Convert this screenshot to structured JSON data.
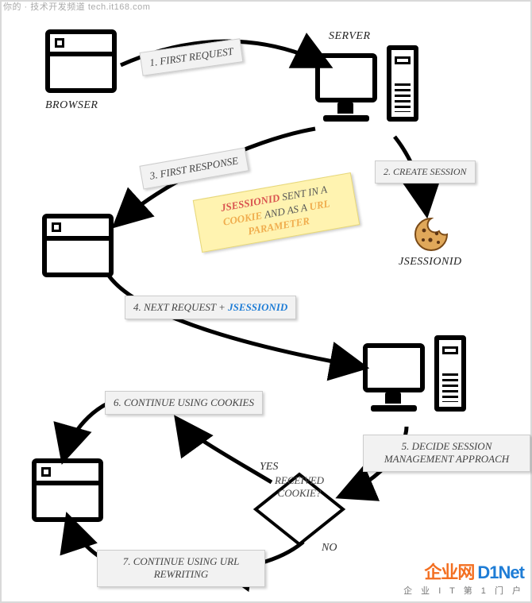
{
  "watermark_top": "你的 · 技术开发频道  tech.it168.com",
  "watermark_bottom": {
    "brand_cn": "企业网",
    "brand_en": "D1Net",
    "tagline": "企 业 I T 第 1 门 户"
  },
  "labels": {
    "browser": "BROWSER",
    "server": "SERVER",
    "jsessionid_caption": "JSESSIONID"
  },
  "steps": {
    "s1": "1. FIRST REQUEST",
    "s2": "2. CREATE SESSION",
    "s3": "3. FIRST RESPONSE",
    "s4_prefix": "4. NEXT REQUEST + ",
    "s4_kw": "JSESSIONID",
    "s5": "5. DECIDE SESSION MANAGEMENT APPROACH",
    "s6": "6. CONTINUE USING COOKIES",
    "s7": "7. CONTINUE USING URL REWRITING"
  },
  "note": {
    "kw_jsid": "JSESSIONID",
    "t1": " SENT IN A ",
    "kw_cookie": "COOKIE",
    "t2": " AND AS A ",
    "kw_url": "URL PARAMETER"
  },
  "decision": {
    "line1": "RECEIVED",
    "line2": "COOKIE?",
    "yes": "YES",
    "no": "NO"
  }
}
